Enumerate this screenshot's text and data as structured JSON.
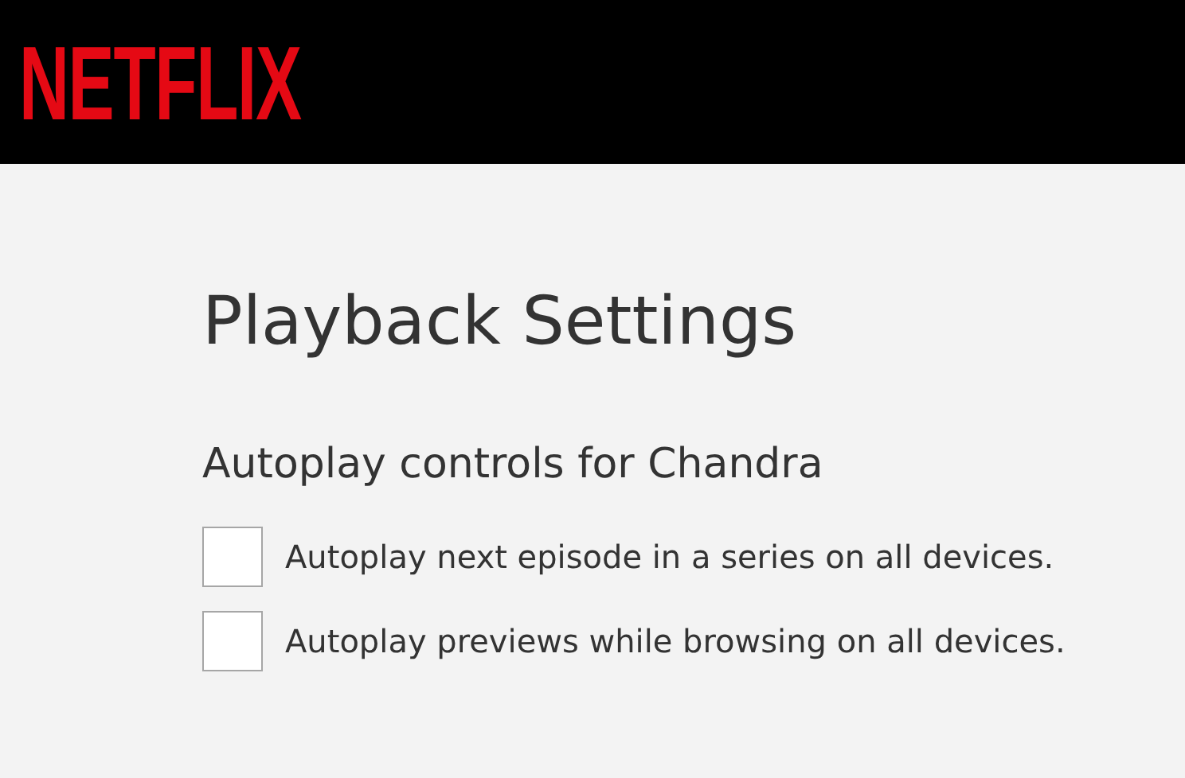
{
  "header": {
    "logo": "NETFLIX"
  },
  "title": "Playback Settings",
  "section": {
    "heading": "Autoplay controls for Chandra",
    "options": [
      {
        "label": "Autoplay next episode in a series on all devices.",
        "checked": false
      },
      {
        "label": "Autoplay previews while browsing on all devices.",
        "checked": false
      }
    ]
  }
}
